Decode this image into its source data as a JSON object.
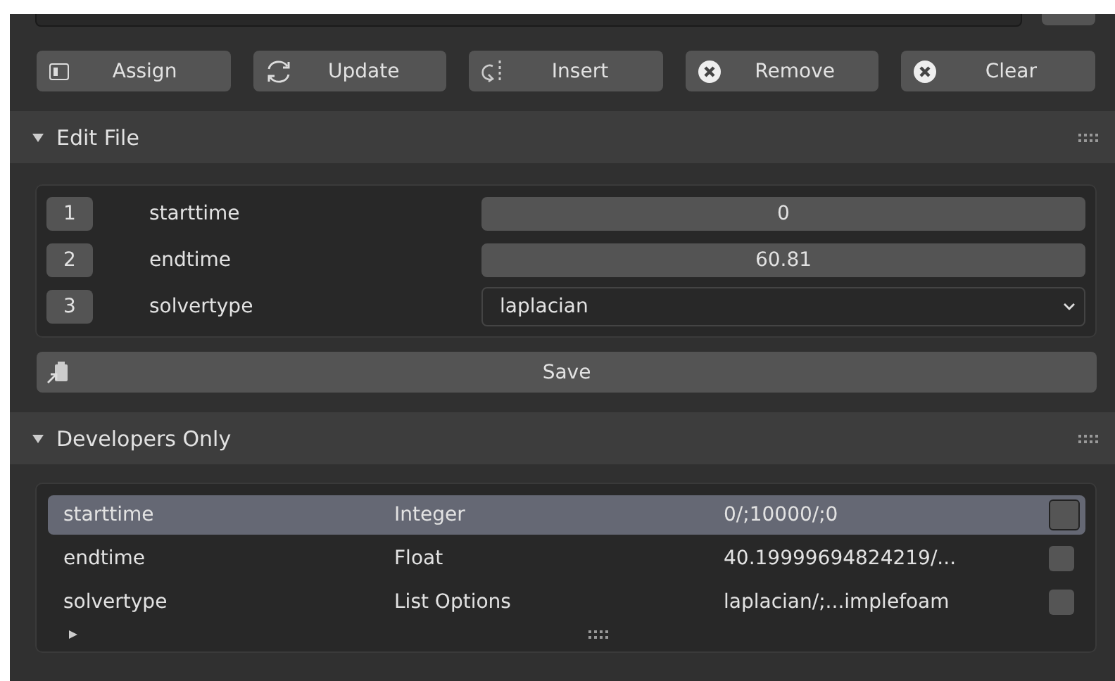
{
  "buttons": [
    {
      "label": "Assign"
    },
    {
      "label": "Update"
    },
    {
      "label": "Insert"
    },
    {
      "label": "Remove"
    },
    {
      "label": "Clear"
    }
  ],
  "edit_file": {
    "title": "Edit File",
    "expanded": true,
    "fields": [
      {
        "index": "1",
        "name": "starttime",
        "kind": "number",
        "value": "0"
      },
      {
        "index": "2",
        "name": "endtime",
        "kind": "number",
        "value": "60.81"
      },
      {
        "index": "3",
        "name": "solvertype",
        "kind": "dropdown",
        "value": "laplacian"
      }
    ],
    "save_button": "Save"
  },
  "developers_only": {
    "title": "Developers Only",
    "expanded": true,
    "rows": [
      {
        "name": "starttime",
        "type": "Integer",
        "value": "0/;10000/;0",
        "checked": false,
        "selected": true
      },
      {
        "name": "endtime",
        "type": "Float",
        "value": "40.19999694824219/...",
        "checked": false,
        "selected": false
      },
      {
        "name": "solvertype",
        "type": "List Options",
        "value": "laplacian/;...implefoam",
        "checked": false,
        "selected": false
      }
    ]
  }
}
